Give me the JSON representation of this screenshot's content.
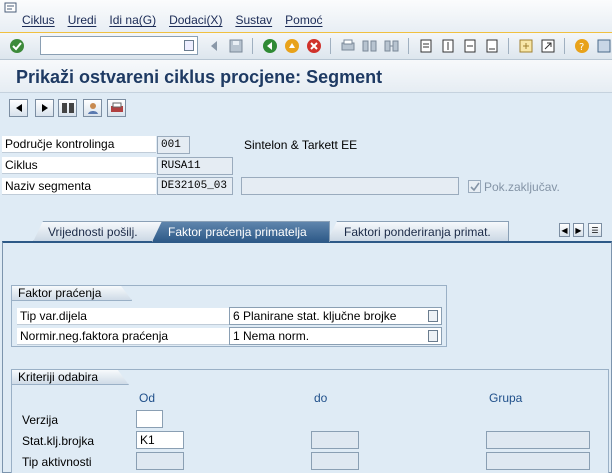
{
  "menu": [
    "Ciklus",
    "Uredi",
    "Idi na(G)",
    "Dodaci(X)",
    "Sustav",
    "Pomoć"
  ],
  "toolbar": {
    "command_value": ""
  },
  "title": "Prikaži ostvareni ciklus procjene: Segment",
  "header": {
    "fields": [
      {
        "label": "Područje kontrolinga",
        "value": "001",
        "text": "Sintelon & Tarkett EE"
      },
      {
        "label": "Ciklus",
        "value": "RUSA11"
      },
      {
        "label": "Naziv segmenta",
        "value": "DE32105_03",
        "text": ""
      }
    ],
    "locked_label": "Pok.zaključav.",
    "locked_checked": true
  },
  "tabs": [
    {
      "label": "Vrijednosti pošilj.",
      "active": false
    },
    {
      "label": "Faktor praćenja primatelja",
      "active": true
    },
    {
      "label": "Faktori ponderiranja primat.",
      "active": false
    }
  ],
  "faktor": {
    "title": "Faktor praćenja",
    "rows": [
      {
        "label": "Tip var.dijela",
        "value": "6 Planirane stat. ključne brojke"
      },
      {
        "label": "Normir.neg.faktora praćenja",
        "value": "1 Nema norm."
      }
    ]
  },
  "kriteriji": {
    "title": "Kriteriji odabira",
    "col_od": "Od",
    "col_do": "do",
    "col_grupa": "Grupa",
    "rows": [
      {
        "label": "Verzija",
        "od": ""
      },
      {
        "label": "Stat.klj.brojka",
        "od": "K1"
      },
      {
        "label": "Tip aktivnosti",
        "od": ""
      }
    ]
  },
  "colors": {
    "title": "#1e3a63",
    "active_tab": "#2d5987",
    "column_header": "#1f4f8a"
  }
}
